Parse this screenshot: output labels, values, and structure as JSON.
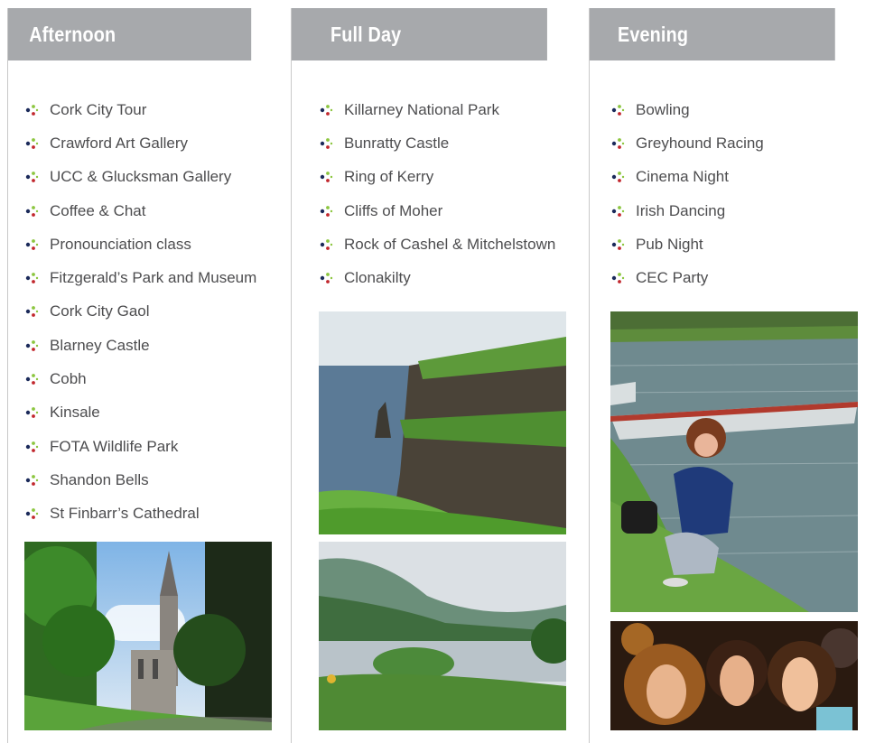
{
  "columns": [
    {
      "title": "Afternoon",
      "items": [
        "Cork City Tour",
        "Crawford Art Gallery",
        "UCC & Glucksman Gallery",
        "Coffee & Chat",
        "Pronounciation class",
        "Fitzgerald’s Park and Museum",
        "Cork City Gaol",
        "Blarney Castle",
        "Cobh",
        "Kinsale",
        "FOTA Wildlife Park",
        "Shandon Bells",
        "St Finbarr’s Cathedral"
      ]
    },
    {
      "title": "Full Day",
      "items": [
        "Killarney National Park",
        "Bunratty Castle",
        "Ring of Kerry",
        "Cliffs of Moher",
        "Rock of Cashel & Mitchelstown",
        "Clonakilty"
      ]
    },
    {
      "title": "Evening",
      "items": [
        "Bowling",
        "Greyhound Racing",
        "Cinema Night",
        "Irish Dancing",
        "Pub Night",
        "CEC Party"
      ]
    }
  ],
  "colors": {
    "header_bg": "#a7a9ac",
    "header_text": "#ffffff",
    "item_text": "#4d4d4f",
    "divider": "#c9c9c9",
    "bullet_green": "#8cc63f",
    "bullet_red": "#c1272d",
    "bullet_navy": "#1b2a5a"
  },
  "icons": {
    "bullet": "three-dot-bullet-icon"
  }
}
